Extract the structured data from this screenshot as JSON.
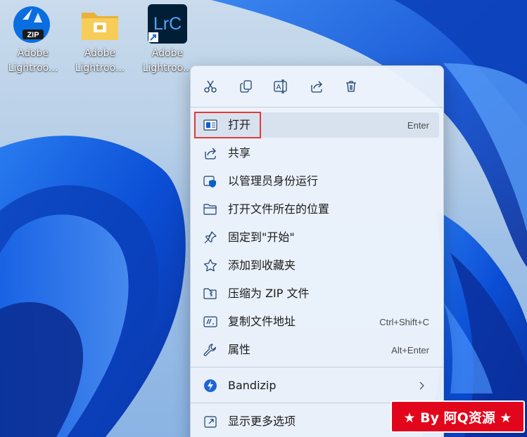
{
  "desktop": {
    "icons": [
      {
        "name": "desktop-icon-adobe-lightroom-zip",
        "label": "Adobe\nLightroo...",
        "badge": "ZIP"
      },
      {
        "name": "desktop-icon-adobe-lightroom-folder",
        "label": "Adobe\nLightroo..."
      },
      {
        "name": "desktop-icon-adobe-lightroom-shortcut",
        "label": "Adobe\nLightroo...",
        "badge": "LrC"
      }
    ]
  },
  "context_menu": {
    "toolbar": [
      {
        "name": "cut-button",
        "icon": "scissors-icon"
      },
      {
        "name": "copy-button",
        "icon": "copy-icon"
      },
      {
        "name": "rename-button",
        "icon": "rename-icon"
      },
      {
        "name": "share-button",
        "icon": "share-icon"
      },
      {
        "name": "delete-button",
        "icon": "trash-icon"
      }
    ],
    "items": [
      {
        "label": "打开",
        "shortcut": "Enter",
        "icon": "open-window-icon"
      },
      {
        "label": "共享",
        "shortcut": "",
        "icon": "share-icon"
      },
      {
        "label": "以管理员身份运行",
        "shortcut": "",
        "icon": "admin-shield-icon"
      },
      {
        "label": "打开文件所在的位置",
        "shortcut": "",
        "icon": "folder-icon"
      },
      {
        "label": "固定到\"开始\"",
        "shortcut": "",
        "icon": "pin-icon"
      },
      {
        "label": "添加到收藏夹",
        "shortcut": "",
        "icon": "star-icon"
      },
      {
        "label": "压缩为 ZIP 文件",
        "shortcut": "",
        "icon": "zip-folder-icon"
      },
      {
        "label": "复制文件地址",
        "shortcut": "Ctrl+Shift+C",
        "icon": "copy-path-icon"
      },
      {
        "label": "属性",
        "shortcut": "Alt+Enter",
        "icon": "wrench-icon"
      },
      {
        "label": "Bandizip",
        "shortcut": "",
        "icon": "bandizip-icon"
      },
      {
        "label": "显示更多选项",
        "shortcut": "",
        "icon": "more-options-icon"
      }
    ]
  },
  "watermark": {
    "text": "★ By 阿Q资源 ★"
  },
  "colors": {
    "accent": "#0067c0",
    "highlight_border": "#e03b3b",
    "watermark_bg": "#e2061c"
  }
}
